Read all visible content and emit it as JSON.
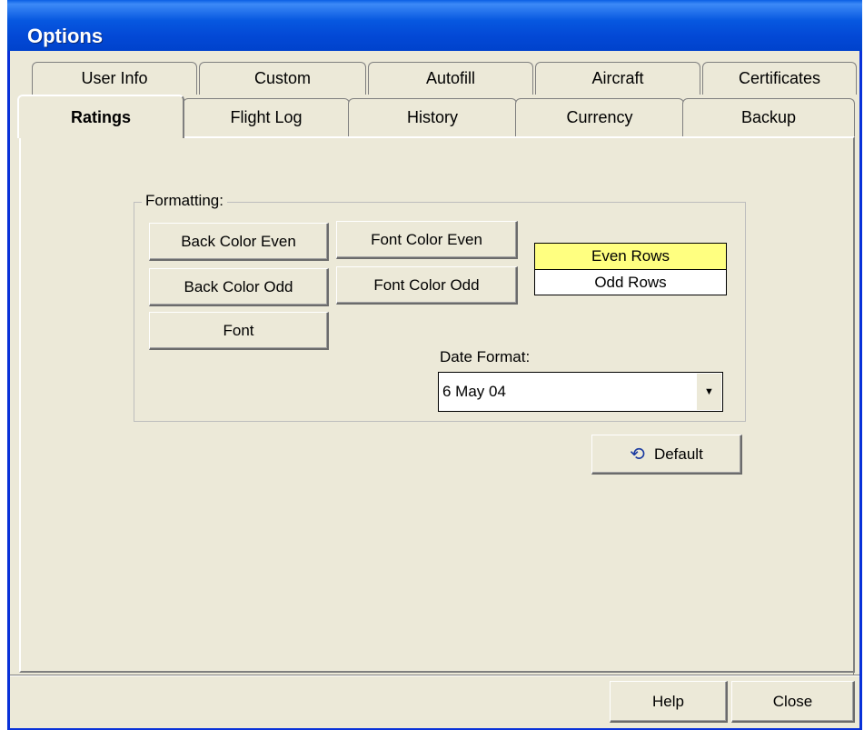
{
  "window": {
    "title": "Options"
  },
  "tabs": {
    "row1": [
      "User Info",
      "Custom",
      "Autofill",
      "Aircraft",
      "Certificates"
    ],
    "row2": [
      "Ratings",
      "Flight Log",
      "History",
      "Currency",
      "Backup"
    ],
    "active": "Ratings"
  },
  "formatting": {
    "legend": "Formatting:",
    "buttons": {
      "back_even": "Back Color Even",
      "font_even": "Font Color Even",
      "back_odd": "Back Color Odd",
      "font_odd": "Font Color Odd",
      "font": "Font"
    },
    "preview": {
      "even_label": "Even Rows",
      "odd_label": "Odd Rows",
      "even_color": "#FFFF80",
      "odd_color": "#FFFFFF"
    },
    "date_format": {
      "label": "Date Format:",
      "value": "6 May 04"
    }
  },
  "default_button": {
    "label": "Default",
    "icon": "undo-arrow-icon"
  },
  "footer": {
    "help_label": "Help",
    "close_label": "Close"
  },
  "colors": {
    "titlebar": "#0758E0",
    "window_bg": "#ECE9D8"
  }
}
